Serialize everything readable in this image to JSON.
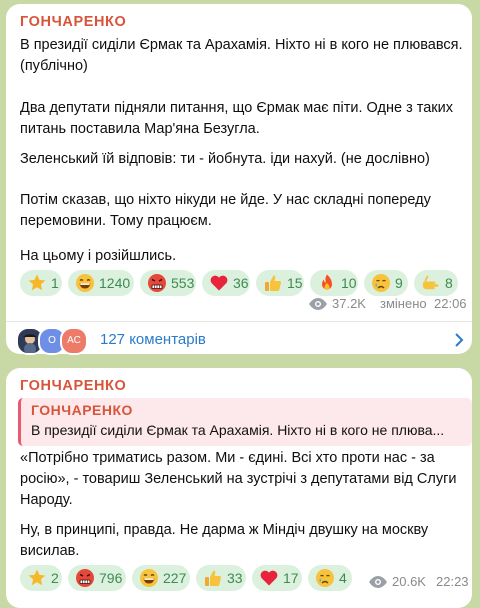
{
  "posts": [
    {
      "sender": "ГОНЧАРЕНКО",
      "paragraphs": [
        [
          "В президії сиділи Єрмак та Арахамія. Ніхто ні в кого не плювався.",
          "(публічно)"
        ],
        [
          "Два депутати підняли питання, що Єрмак має піти. Одне з таких",
          "питань поставила Мар'яна Безугла."
        ],
        [
          "Зеленський їй відповів: ти - йобнута. іди нахуй. (не дослівно)"
        ],
        [
          "Потім сказав, що ніхто нікуди не йде. У нас складні попереду",
          "перемовини. Тому працюєм."
        ],
        [
          "На цьому і розійшлись."
        ]
      ],
      "reactions": [
        {
          "icon": "star-icon",
          "count": "1"
        },
        {
          "icon": "grin-face-icon",
          "count": "1240"
        },
        {
          "icon": "angry-face-icon",
          "count": "553"
        },
        {
          "icon": "heart-icon",
          "count": "36"
        },
        {
          "icon": "thumbs-up-icon",
          "count": "15"
        },
        {
          "icon": "fire-icon",
          "count": "10"
        },
        {
          "icon": "crying-face-icon",
          "count": "9"
        },
        {
          "icon": "hand-icon",
          "count": "8"
        }
      ],
      "views": "37.2K",
      "edited": "змінено",
      "time": "22:06",
      "comments": {
        "label": "127 коментарів",
        "avatars": [
          "",
          "О",
          "АС"
        ]
      }
    },
    {
      "sender": "ГОНЧАРЕНКО",
      "reply": {
        "sender": "ГОНЧАРЕНКО",
        "text": "В президії сиділи Єрмак та Арахамія. Ніхто ні в кого не плюва..."
      },
      "paragraphs": [
        [
          "«Потрібно триматись разом. Ми - єдині. Всі хто проти нас - за",
          "росію», - товариш Зеленський на зустрічі з депутатами від Слуги",
          "Народу."
        ],
        [
          "Ну, в принципі, правда. Не дарма ж Міндіч двушку на москву",
          "висилав."
        ]
      ],
      "reactions": [
        {
          "icon": "star-icon",
          "count": "2"
        },
        {
          "icon": "angry-face-icon",
          "count": "796"
        },
        {
          "icon": "grin-face-icon",
          "count": "227"
        },
        {
          "icon": "thumbs-up-icon",
          "count": "33"
        },
        {
          "icon": "heart-icon",
          "count": "17"
        },
        {
          "icon": "crying-face-icon",
          "count": "4"
        }
      ],
      "views": "20.6K",
      "time": "22:23"
    }
  ]
}
